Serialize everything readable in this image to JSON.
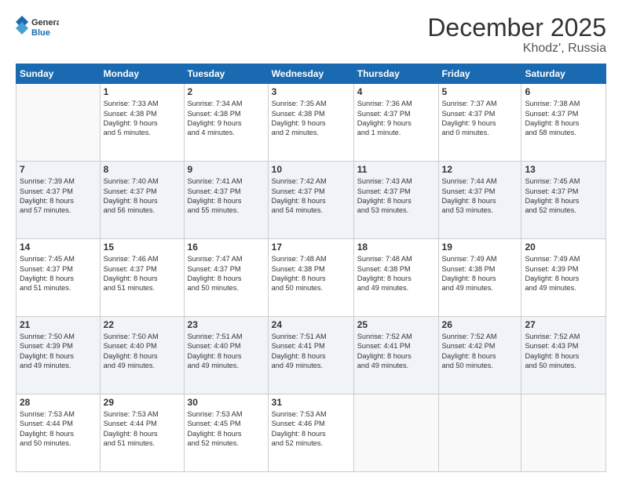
{
  "header": {
    "logo_general": "General",
    "logo_blue": "Blue",
    "month": "December 2025",
    "location": "Khodz', Russia"
  },
  "days_of_week": [
    "Sunday",
    "Monday",
    "Tuesday",
    "Wednesday",
    "Thursday",
    "Friday",
    "Saturday"
  ],
  "weeks": [
    [
      {
        "day": null,
        "lines": []
      },
      {
        "day": "1",
        "lines": [
          "Sunrise: 7:33 AM",
          "Sunset: 4:38 PM",
          "Daylight: 9 hours",
          "and 5 minutes."
        ]
      },
      {
        "day": "2",
        "lines": [
          "Sunrise: 7:34 AM",
          "Sunset: 4:38 PM",
          "Daylight: 9 hours",
          "and 4 minutes."
        ]
      },
      {
        "day": "3",
        "lines": [
          "Sunrise: 7:35 AM",
          "Sunset: 4:38 PM",
          "Daylight: 9 hours",
          "and 2 minutes."
        ]
      },
      {
        "day": "4",
        "lines": [
          "Sunrise: 7:36 AM",
          "Sunset: 4:37 PM",
          "Daylight: 9 hours",
          "and 1 minute."
        ]
      },
      {
        "day": "5",
        "lines": [
          "Sunrise: 7:37 AM",
          "Sunset: 4:37 PM",
          "Daylight: 9 hours",
          "and 0 minutes."
        ]
      },
      {
        "day": "6",
        "lines": [
          "Sunrise: 7:38 AM",
          "Sunset: 4:37 PM",
          "Daylight: 8 hours",
          "and 58 minutes."
        ]
      }
    ],
    [
      {
        "day": "7",
        "lines": [
          "Sunrise: 7:39 AM",
          "Sunset: 4:37 PM",
          "Daylight: 8 hours",
          "and 57 minutes."
        ]
      },
      {
        "day": "8",
        "lines": [
          "Sunrise: 7:40 AM",
          "Sunset: 4:37 PM",
          "Daylight: 8 hours",
          "and 56 minutes."
        ]
      },
      {
        "day": "9",
        "lines": [
          "Sunrise: 7:41 AM",
          "Sunset: 4:37 PM",
          "Daylight: 8 hours",
          "and 55 minutes."
        ]
      },
      {
        "day": "10",
        "lines": [
          "Sunrise: 7:42 AM",
          "Sunset: 4:37 PM",
          "Daylight: 8 hours",
          "and 54 minutes."
        ]
      },
      {
        "day": "11",
        "lines": [
          "Sunrise: 7:43 AM",
          "Sunset: 4:37 PM",
          "Daylight: 8 hours",
          "and 53 minutes."
        ]
      },
      {
        "day": "12",
        "lines": [
          "Sunrise: 7:44 AM",
          "Sunset: 4:37 PM",
          "Daylight: 8 hours",
          "and 53 minutes."
        ]
      },
      {
        "day": "13",
        "lines": [
          "Sunrise: 7:45 AM",
          "Sunset: 4:37 PM",
          "Daylight: 8 hours",
          "and 52 minutes."
        ]
      }
    ],
    [
      {
        "day": "14",
        "lines": [
          "Sunrise: 7:45 AM",
          "Sunset: 4:37 PM",
          "Daylight: 8 hours",
          "and 51 minutes."
        ]
      },
      {
        "day": "15",
        "lines": [
          "Sunrise: 7:46 AM",
          "Sunset: 4:37 PM",
          "Daylight: 8 hours",
          "and 51 minutes."
        ]
      },
      {
        "day": "16",
        "lines": [
          "Sunrise: 7:47 AM",
          "Sunset: 4:37 PM",
          "Daylight: 8 hours",
          "and 50 minutes."
        ]
      },
      {
        "day": "17",
        "lines": [
          "Sunrise: 7:48 AM",
          "Sunset: 4:38 PM",
          "Daylight: 8 hours",
          "and 50 minutes."
        ]
      },
      {
        "day": "18",
        "lines": [
          "Sunrise: 7:48 AM",
          "Sunset: 4:38 PM",
          "Daylight: 8 hours",
          "and 49 minutes."
        ]
      },
      {
        "day": "19",
        "lines": [
          "Sunrise: 7:49 AM",
          "Sunset: 4:38 PM",
          "Daylight: 8 hours",
          "and 49 minutes."
        ]
      },
      {
        "day": "20",
        "lines": [
          "Sunrise: 7:49 AM",
          "Sunset: 4:39 PM",
          "Daylight: 8 hours",
          "and 49 minutes."
        ]
      }
    ],
    [
      {
        "day": "21",
        "lines": [
          "Sunrise: 7:50 AM",
          "Sunset: 4:39 PM",
          "Daylight: 8 hours",
          "and 49 minutes."
        ]
      },
      {
        "day": "22",
        "lines": [
          "Sunrise: 7:50 AM",
          "Sunset: 4:40 PM",
          "Daylight: 8 hours",
          "and 49 minutes."
        ]
      },
      {
        "day": "23",
        "lines": [
          "Sunrise: 7:51 AM",
          "Sunset: 4:40 PM",
          "Daylight: 8 hours",
          "and 49 minutes."
        ]
      },
      {
        "day": "24",
        "lines": [
          "Sunrise: 7:51 AM",
          "Sunset: 4:41 PM",
          "Daylight: 8 hours",
          "and 49 minutes."
        ]
      },
      {
        "day": "25",
        "lines": [
          "Sunrise: 7:52 AM",
          "Sunset: 4:41 PM",
          "Daylight: 8 hours",
          "and 49 minutes."
        ]
      },
      {
        "day": "26",
        "lines": [
          "Sunrise: 7:52 AM",
          "Sunset: 4:42 PM",
          "Daylight: 8 hours",
          "and 50 minutes."
        ]
      },
      {
        "day": "27",
        "lines": [
          "Sunrise: 7:52 AM",
          "Sunset: 4:43 PM",
          "Daylight: 8 hours",
          "and 50 minutes."
        ]
      }
    ],
    [
      {
        "day": "28",
        "lines": [
          "Sunrise: 7:53 AM",
          "Sunset: 4:44 PM",
          "Daylight: 8 hours",
          "and 50 minutes."
        ]
      },
      {
        "day": "29",
        "lines": [
          "Sunrise: 7:53 AM",
          "Sunset: 4:44 PM",
          "Daylight: 8 hours",
          "and 51 minutes."
        ]
      },
      {
        "day": "30",
        "lines": [
          "Sunrise: 7:53 AM",
          "Sunset: 4:45 PM",
          "Daylight: 8 hours",
          "and 52 minutes."
        ]
      },
      {
        "day": "31",
        "lines": [
          "Sunrise: 7:53 AM",
          "Sunset: 4:46 PM",
          "Daylight: 8 hours",
          "and 52 minutes."
        ]
      },
      {
        "day": null,
        "lines": []
      },
      {
        "day": null,
        "lines": []
      },
      {
        "day": null,
        "lines": []
      }
    ]
  ]
}
